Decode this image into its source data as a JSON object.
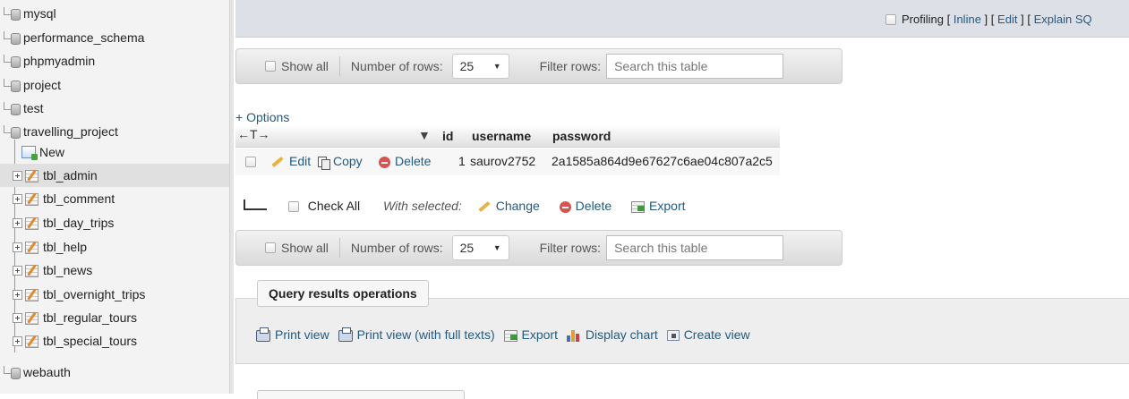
{
  "sidebar": {
    "items": [
      {
        "label": "mysql"
      },
      {
        "label": "performance_schema"
      },
      {
        "label": "phpmyadmin"
      },
      {
        "label": "project"
      },
      {
        "label": "test"
      },
      {
        "label": "travelling_project"
      }
    ],
    "new_label": "New",
    "tables": [
      {
        "label": "tbl_admin"
      },
      {
        "label": "tbl_comment"
      },
      {
        "label": "tbl_day_trips"
      },
      {
        "label": "tbl_help"
      },
      {
        "label": "tbl_news"
      },
      {
        "label": "tbl_overnight_trips"
      },
      {
        "label": "tbl_regular_tours"
      },
      {
        "label": "tbl_special_tours"
      }
    ],
    "last_db": "webauth"
  },
  "topbar": {
    "profiling": "Profiling",
    "open_bracket": "[",
    "close_bracket": "]",
    "inline": "Inline",
    "edit": "Edit",
    "explain": "Explain SQ"
  },
  "navbar": {
    "show_all": "Show all",
    "rows_label": "Number of rows:",
    "rows_value": "25",
    "filter_label": "Filter rows:",
    "search_placeholder": "Search this table"
  },
  "results": {
    "options": "+ Options",
    "sort_arrows": "←T→",
    "columns": [
      "id",
      "username",
      "password"
    ],
    "row": {
      "edit": "Edit",
      "copy": "Copy",
      "delete": "Delete",
      "id": "1",
      "username": "saurov2752",
      "password": "2a1585a864d9e67627c6ae04c807a2c5"
    }
  },
  "bulk": {
    "check_all": "Check All",
    "with_selected": "With selected:",
    "change": "Change",
    "delete": "Delete",
    "export": "Export"
  },
  "query_ops": {
    "legend": "Query results operations",
    "print_view": "Print view",
    "print_view_full": "Print view (with full texts)",
    "export": "Export",
    "display_chart": "Display chart",
    "create_view": "Create view"
  },
  "colors": {
    "link": "#235a81",
    "topbar_bg": "#dde1e7",
    "sidebar_bg": "#f3f3f3",
    "active_row": "#e0e0e0"
  }
}
